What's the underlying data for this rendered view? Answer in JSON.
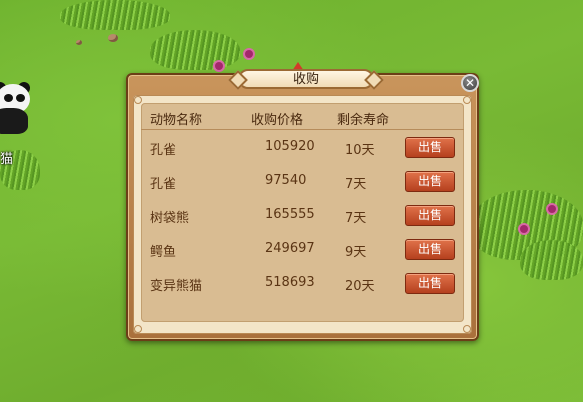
{
  "scene": {
    "panda_label": "猫"
  },
  "dialog": {
    "title": "收购",
    "close_label": "✕",
    "headers": {
      "name": "动物名称",
      "price": "收购价格",
      "lifespan": "剩余寿命"
    },
    "rows": [
      {
        "name": "孔雀",
        "price": "105920",
        "lifespan": "10天",
        "action": "出售"
      },
      {
        "name": "孔雀",
        "price": "97540",
        "lifespan": "7天",
        "action": "出售"
      },
      {
        "name": "树袋熊",
        "price": "165555",
        "lifespan": "7天",
        "action": "出售"
      },
      {
        "name": "鳄鱼",
        "price": "249697",
        "lifespan": "9天",
        "action": "出售"
      },
      {
        "name": "变异熊猫",
        "price": "518693",
        "lifespan": "20天",
        "action": "出售"
      }
    ]
  },
  "colors": {
    "grass": "#76b833",
    "dialog_frame": "#a9703c",
    "panel": "#d9bc92",
    "sell_button": "#c9532c"
  }
}
